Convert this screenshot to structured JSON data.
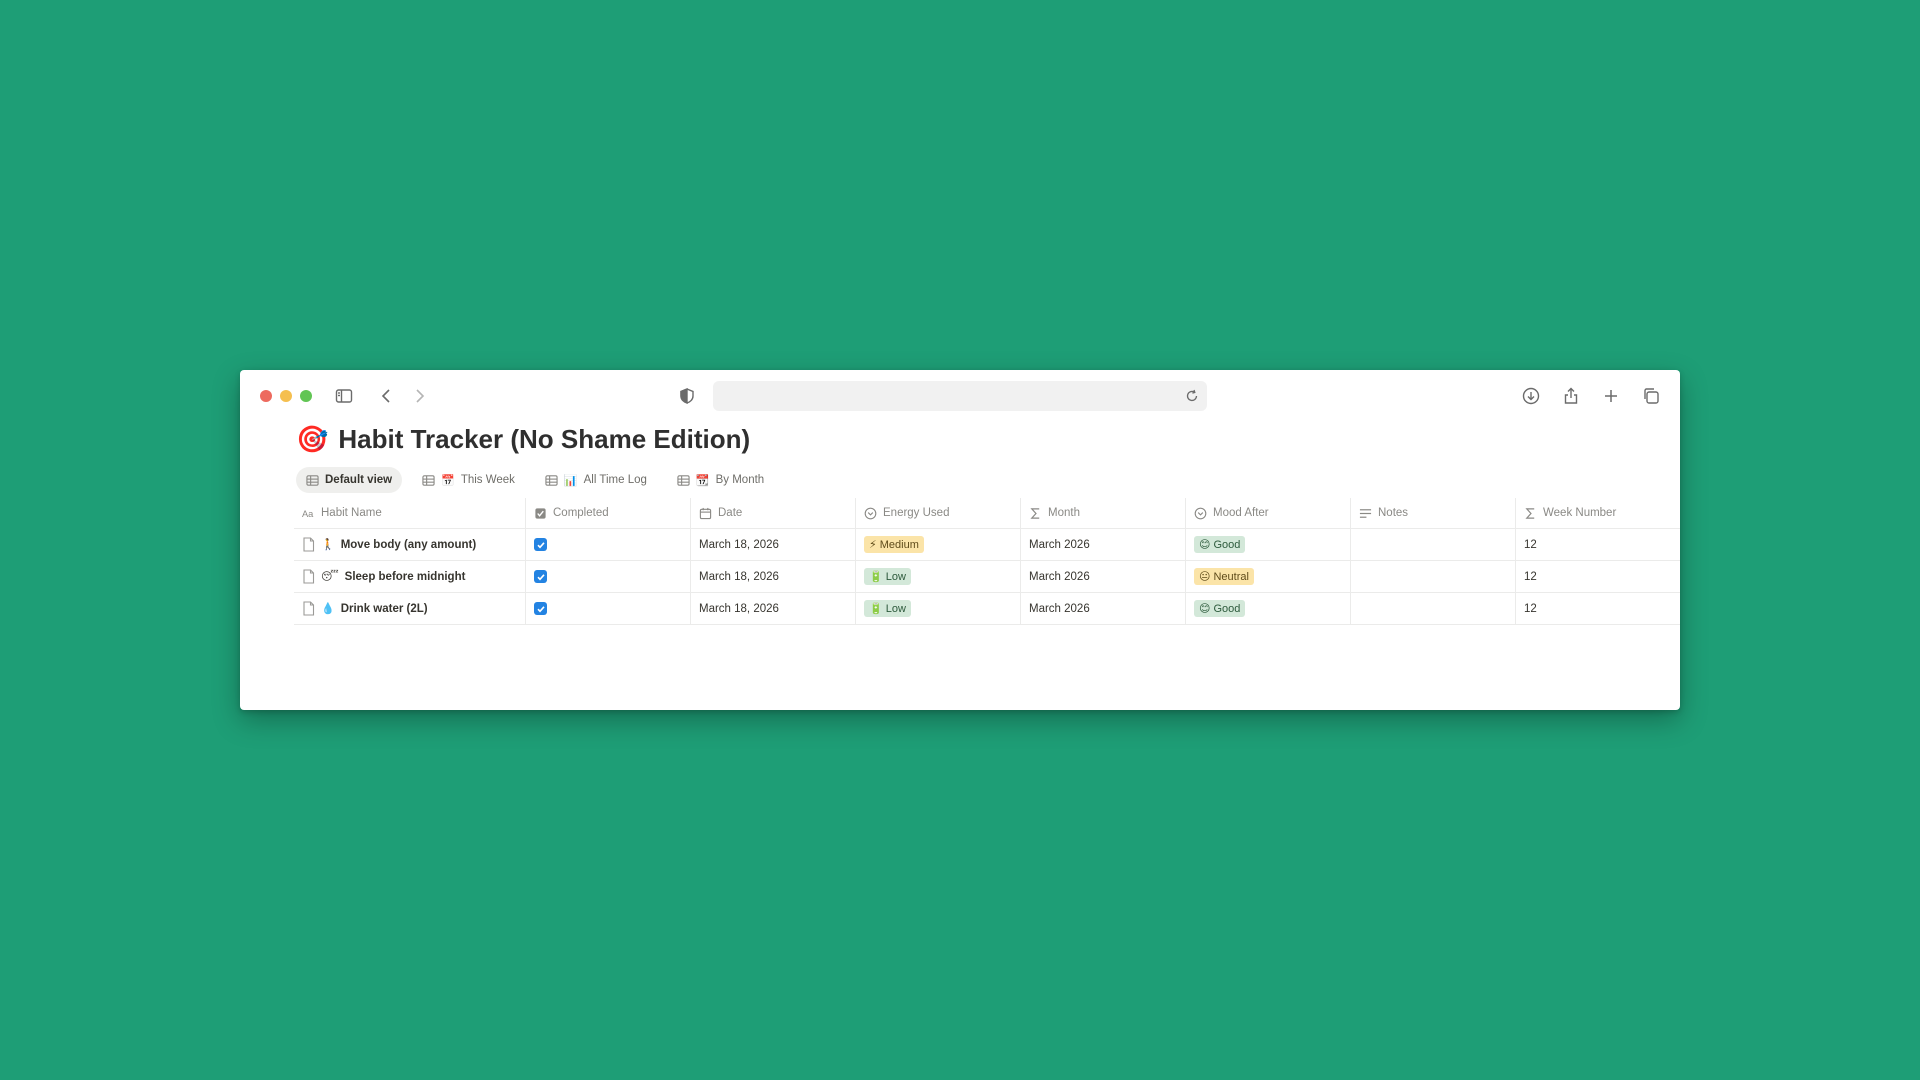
{
  "page": {
    "title": "Habit Tracker (No Shame Edition)",
    "title_emoji": "🎯"
  },
  "views": [
    {
      "label": "Default view",
      "emoji": "",
      "active": true
    },
    {
      "label": "This Week",
      "emoji": "📅",
      "active": false
    },
    {
      "label": "All Time Log",
      "emoji": "📊",
      "active": false
    },
    {
      "label": "By Month",
      "emoji": "📆",
      "active": false
    }
  ],
  "columns": [
    {
      "label": "Habit Name",
      "icon": "title-icon"
    },
    {
      "label": "Completed",
      "icon": "checkbox-icon"
    },
    {
      "label": "Date",
      "icon": "calendar-icon"
    },
    {
      "label": "Energy Used",
      "icon": "select-icon"
    },
    {
      "label": "Month",
      "icon": "formula-icon"
    },
    {
      "label": "Mood After",
      "icon": "select-icon"
    },
    {
      "label": "Notes",
      "icon": "text-icon"
    },
    {
      "label": "Week Number",
      "icon": "formula-icon"
    }
  ],
  "rows": [
    {
      "emoji": "🚶",
      "name": "Move body (any amount)",
      "completed": true,
      "date": "March 18, 2026",
      "energy": {
        "emoji": "⚡",
        "label": "Medium"
      },
      "month": "March 2026",
      "mood": {
        "emoji": "😊",
        "label": "Good"
      },
      "notes": "",
      "week": "12"
    },
    {
      "emoji": "😴",
      "name": "Sleep before midnight",
      "completed": true,
      "date": "March 18, 2026",
      "energy": {
        "emoji": "🔋",
        "label": "Low"
      },
      "month": "March 2026",
      "mood": {
        "emoji": "😐",
        "label": "Neutral"
      },
      "notes": "",
      "week": "12"
    },
    {
      "emoji": "💧",
      "name": "Drink water (2L)",
      "completed": true,
      "date": "March 18, 2026",
      "energy": {
        "emoji": "🔋",
        "label": "Low"
      },
      "month": "March 2026",
      "mood": {
        "emoji": "😊",
        "label": "Good"
      },
      "notes": "",
      "week": "12"
    }
  ],
  "colors": {
    "background": "#1e9e76",
    "checkbox": "#2383e2",
    "tag_yellow": "#fbe4a8",
    "tag_green": "#d3e8d9"
  }
}
